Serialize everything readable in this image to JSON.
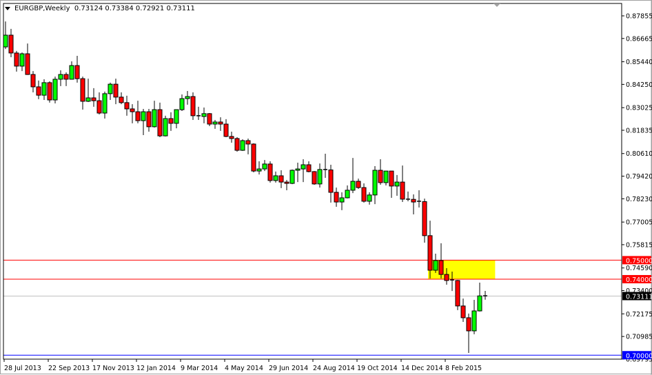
{
  "header": {
    "symbol_timeframe": "EURGBP,Weekly",
    "ohlc": "0.73124 0.73384 0.72921 0.73111"
  },
  "colors": {
    "bull": "#00ff00",
    "bear": "#ff0000",
    "level_red": "#ff0000",
    "level_blue": "#0000ff",
    "bid_line": "#c0c0c0",
    "zone": "#ffff00"
  },
  "chart_data": {
    "type": "candlestick",
    "title": "EURGBP,Weekly",
    "ylim": [
      0.69795,
      0.87855
    ],
    "y_ticks": [
      "0.87855",
      "0.86665",
      "0.85440",
      "0.84250",
      "0.83025",
      "0.81835",
      "0.80610",
      "0.79420",
      "0.78230",
      "0.77005",
      "0.75815",
      "0.74590",
      "0.73400",
      "0.72175",
      "0.70985",
      "0.69795"
    ],
    "x_ticks": [
      {
        "index": 0,
        "label": "28 Jul 2013"
      },
      {
        "index": 8,
        "label": "22 Sep 2013"
      },
      {
        "index": 16,
        "label": "17 Nov 2013"
      },
      {
        "index": 24,
        "label": "12 Jan 2014"
      },
      {
        "index": 32,
        "label": "9 Mar 2014"
      },
      {
        "index": 40,
        "label": "4 May 2014"
      },
      {
        "index": 48,
        "label": "29 Jun 2014"
      },
      {
        "index": 56,
        "label": "24 Aug 2014"
      },
      {
        "index": 64,
        "label": "19 Oct 2014"
      },
      {
        "index": 72,
        "label": "14 Dec 2014"
      },
      {
        "index": 80,
        "label": "8 Feb 2015"
      }
    ],
    "levels": [
      {
        "price": 0.75,
        "label": "0.75000",
        "color": "#ff0000"
      },
      {
        "price": 0.74,
        "label": "0.74000",
        "color": "#ff0000"
      },
      {
        "price": 0.7,
        "label": "0.70000",
        "color": "#0000ff"
      }
    ],
    "bid": {
      "price": 0.73111,
      "label": "0.73111"
    },
    "zone": {
      "price_top": 0.75,
      "price_bottom": 0.74,
      "start_index": 77,
      "end_index": 88.8
    },
    "ohlc": [
      [
        0.8622,
        0.8756,
        0.8611,
        0.8684
      ],
      [
        0.8684,
        0.8717,
        0.8568,
        0.859
      ],
      [
        0.859,
        0.8601,
        0.8492,
        0.8521
      ],
      [
        0.8521,
        0.8593,
        0.8495,
        0.8586
      ],
      [
        0.8586,
        0.864,
        0.8475,
        0.8477
      ],
      [
        0.8477,
        0.8495,
        0.8383,
        0.8412
      ],
      [
        0.8412,
        0.8445,
        0.8347,
        0.8368
      ],
      [
        0.8368,
        0.8452,
        0.8343,
        0.8434
      ],
      [
        0.8434,
        0.8441,
        0.8329,
        0.8343
      ],
      [
        0.8343,
        0.8466,
        0.8325,
        0.8452
      ],
      [
        0.8452,
        0.8499,
        0.8416,
        0.8477
      ],
      [
        0.8477,
        0.8488,
        0.8416,
        0.8452
      ],
      [
        0.8452,
        0.8546,
        0.845,
        0.8524
      ],
      [
        0.8524,
        0.8575,
        0.8434,
        0.8455
      ],
      [
        0.8455,
        0.8466,
        0.8292,
        0.8336
      ],
      [
        0.8336,
        0.8455,
        0.8332,
        0.8354
      ],
      [
        0.8354,
        0.8405,
        0.8307,
        0.8339
      ],
      [
        0.8339,
        0.8383,
        0.8267,
        0.8274
      ],
      [
        0.8274,
        0.8387,
        0.8245,
        0.8376
      ],
      [
        0.8376,
        0.8434,
        0.8343,
        0.8426
      ],
      [
        0.8426,
        0.8455,
        0.8321,
        0.8358
      ],
      [
        0.8358,
        0.8383,
        0.8321,
        0.8329
      ],
      [
        0.8329,
        0.8365,
        0.826,
        0.8296
      ],
      [
        0.8296,
        0.8321,
        0.822,
        0.8281
      ],
      [
        0.8281,
        0.8339,
        0.822,
        0.8234
      ],
      [
        0.8234,
        0.8296,
        0.8158,
        0.8281
      ],
      [
        0.8281,
        0.8296,
        0.8176,
        0.8202
      ],
      [
        0.8202,
        0.8339,
        0.8198,
        0.8292
      ],
      [
        0.8292,
        0.8329,
        0.8147,
        0.8154
      ],
      [
        0.8154,
        0.826,
        0.8151,
        0.8245
      ],
      [
        0.8245,
        0.8278,
        0.818,
        0.822
      ],
      [
        0.822,
        0.8292,
        0.8194,
        0.8292
      ],
      [
        0.8292,
        0.8372,
        0.8285,
        0.835
      ],
      [
        0.835,
        0.839,
        0.8318,
        0.8361
      ],
      [
        0.8361,
        0.8383,
        0.8238,
        0.826
      ],
      [
        0.826,
        0.8307,
        0.8238,
        0.8256
      ],
      [
        0.8256,
        0.8303,
        0.822,
        0.8271
      ],
      [
        0.8271,
        0.8274,
        0.8205,
        0.8216
      ],
      [
        0.8216,
        0.8238,
        0.8191,
        0.8227
      ],
      [
        0.8227,
        0.8252,
        0.818,
        0.8216
      ],
      [
        0.8216,
        0.8242,
        0.8147,
        0.8151
      ],
      [
        0.8151,
        0.8176,
        0.8118,
        0.814
      ],
      [
        0.814,
        0.8147,
        0.8071,
        0.8078
      ],
      [
        0.8078,
        0.8136,
        0.8075,
        0.8129
      ],
      [
        0.8129,
        0.814,
        0.8057,
        0.8111
      ],
      [
        0.8111,
        0.8115,
        0.7962,
        0.7969
      ],
      [
        0.7969,
        0.802,
        0.7951,
        0.798
      ],
      [
        0.798,
        0.8027,
        0.7969,
        0.8006
      ],
      [
        0.8006,
        0.802,
        0.7908,
        0.7919
      ],
      [
        0.7919,
        0.7966,
        0.7908,
        0.7944
      ],
      [
        0.7944,
        0.7973,
        0.7879,
        0.7911
      ],
      [
        0.7911,
        0.7922,
        0.7868,
        0.7904
      ],
      [
        0.7904,
        0.7977,
        0.79,
        0.7973
      ],
      [
        0.7973,
        0.8013,
        0.7911,
        0.798
      ],
      [
        0.798,
        0.8031,
        0.7911,
        0.8002
      ],
      [
        0.8002,
        0.802,
        0.7962,
        0.7966
      ],
      [
        0.7966,
        0.7969,
        0.7897,
        0.7901
      ],
      [
        0.7901,
        0.8009,
        0.7882,
        0.7977
      ],
      [
        0.7977,
        0.806,
        0.7933,
        0.7975
      ],
      [
        0.7975,
        0.8002,
        0.7803,
        0.7857
      ],
      [
        0.7857,
        0.7882,
        0.7781,
        0.7806
      ],
      [
        0.7806,
        0.7857,
        0.7763,
        0.7828
      ],
      [
        0.7828,
        0.7893,
        0.7825,
        0.7868
      ],
      [
        0.7868,
        0.8038,
        0.7853,
        0.7915
      ],
      [
        0.7915,
        0.7929,
        0.7875,
        0.7882
      ],
      [
        0.7882,
        0.7904,
        0.7803,
        0.781
      ],
      [
        0.781,
        0.7857,
        0.7792,
        0.7843
      ],
      [
        0.7843,
        0.7995,
        0.7795,
        0.7973
      ],
      [
        0.7973,
        0.8031,
        0.7897,
        0.7908
      ],
      [
        0.7908,
        0.7969,
        0.7893,
        0.7969
      ],
      [
        0.7969,
        0.7969,
        0.7828,
        0.789
      ],
      [
        0.789,
        0.7948,
        0.7839,
        0.7911
      ],
      [
        0.7911,
        0.7998,
        0.7806,
        0.7821
      ],
      [
        0.7821,
        0.7861,
        0.781,
        0.782
      ],
      [
        0.782,
        0.7846,
        0.7741,
        0.7806
      ],
      [
        0.781,
        0.7868,
        0.7777,
        0.7808
      ],
      [
        0.7808,
        0.7824,
        0.7592,
        0.7629
      ],
      [
        0.7629,
        0.7708,
        0.7404,
        0.7447
      ],
      [
        0.7447,
        0.7534,
        0.7433,
        0.7498
      ],
      [
        0.7498,
        0.7589,
        0.7404,
        0.7425
      ],
      [
        0.7425,
        0.7458,
        0.7371,
        0.7393
      ],
      [
        0.7396,
        0.744,
        0.7338,
        0.7393
      ],
      [
        0.7393,
        0.7396,
        0.7237,
        0.7259
      ],
      [
        0.7259,
        0.7298,
        0.7175,
        0.7197
      ],
      [
        0.7197,
        0.7219,
        0.7012,
        0.7128
      ],
      [
        0.7128,
        0.7291,
        0.711,
        0.7233
      ],
      [
        0.7233,
        0.7382,
        0.723,
        0.7312
      ],
      [
        0.73124,
        0.73384,
        0.72921,
        0.73111
      ]
    ]
  }
}
